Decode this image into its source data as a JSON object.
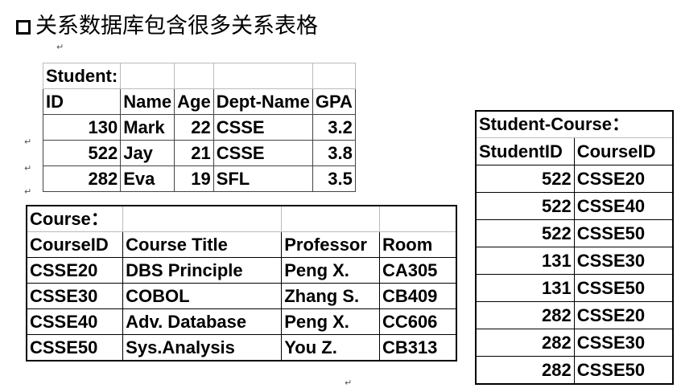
{
  "title": "关系数据库包含很多关系表格",
  "student": {
    "caption": "Student:",
    "headers": [
      "ID",
      "Name",
      "Age",
      "Dept-Name",
      "GPA"
    ],
    "rows": [
      [
        "130",
        "Mark",
        "22",
        "CSSE",
        "3.2"
      ],
      [
        "522",
        "Jay",
        "21",
        "CSSE",
        "3.8"
      ],
      [
        "282",
        "Eva",
        "19",
        "SFL",
        "3.5"
      ]
    ]
  },
  "course": {
    "caption": "Course：",
    "headers": [
      "CourseID",
      "Course Title",
      "Professor",
      "Room"
    ],
    "rows": [
      [
        "CSSE20",
        "DBS Principle",
        "Peng X.",
        "CA305"
      ],
      [
        "CSSE30",
        "COBOL",
        "Zhang S.",
        "CB409"
      ],
      [
        "CSSE40",
        "Adv. Database",
        "Peng X.",
        "CC606"
      ],
      [
        "CSSE50",
        "Sys.Analysis",
        "You Z.",
        "CB313"
      ]
    ]
  },
  "student_course": {
    "caption": "Student-Course：",
    "headers": [
      "StudentID",
      "CourseID"
    ],
    "rows": [
      [
        "522",
        "CSSE20"
      ],
      [
        "522",
        "CSSE40"
      ],
      [
        "522",
        "CSSE50"
      ],
      [
        "131",
        "CSSE30"
      ],
      [
        "131",
        "CSSE50"
      ],
      [
        "282",
        "CSSE20"
      ],
      [
        "282",
        "CSSE30"
      ],
      [
        "282",
        "CSSE50"
      ]
    ]
  },
  "paragraph_mark": "↵"
}
